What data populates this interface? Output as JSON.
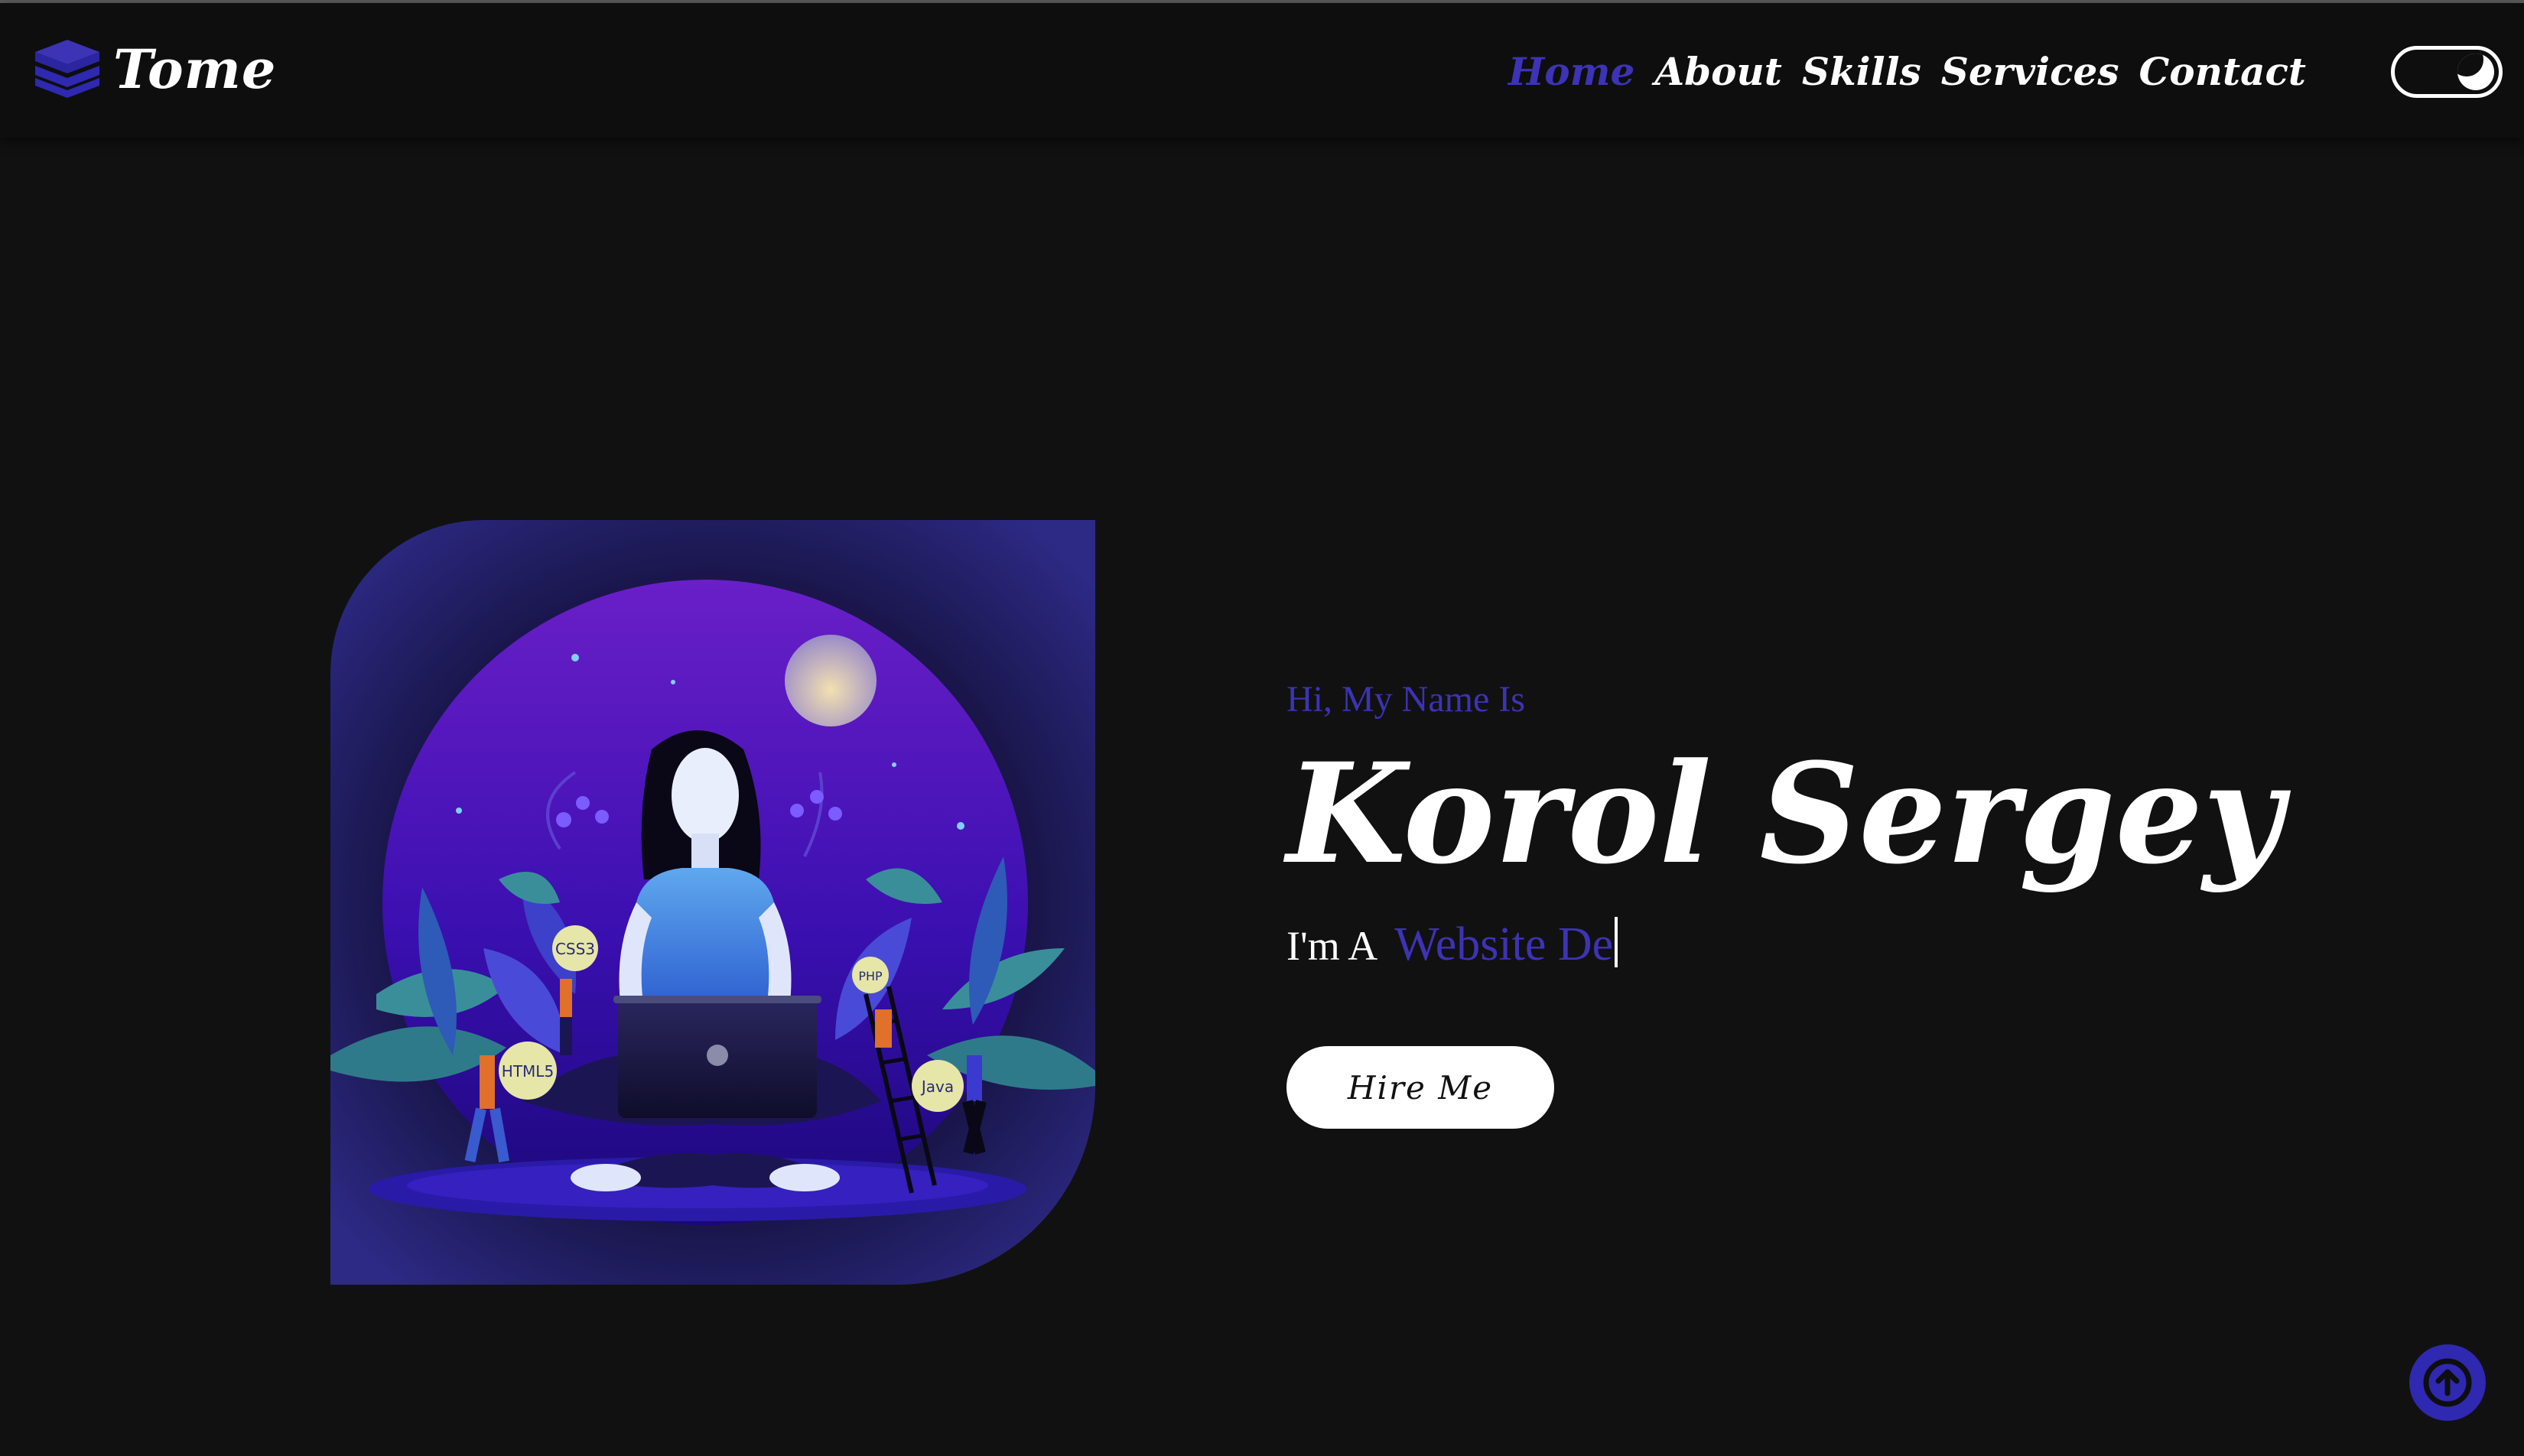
{
  "brand": {
    "name": "Tome",
    "icon": "stacked-layers-icon"
  },
  "nav": {
    "items": [
      {
        "label": "Home",
        "active": true
      },
      {
        "label": "About",
        "active": false
      },
      {
        "label": "Skills",
        "active": false
      },
      {
        "label": "Services",
        "active": false
      },
      {
        "label": "Contact",
        "active": false
      }
    ]
  },
  "theme_toggle": {
    "icon": "moon-icon",
    "state": "dark"
  },
  "hero": {
    "greeting": "Hi, My Name Is",
    "name": "Korol Sergey",
    "role_prefix": "I'm A",
    "role_typed": "Website De",
    "cta_label": "Hire Me",
    "illustration_badges": [
      "CSS3",
      "PHP",
      "HTML5",
      "Java"
    ]
  },
  "colors": {
    "accent": "#3d33b5",
    "background": "#111111",
    "navbar": "#0e0e0e",
    "text": "#ffffff"
  },
  "scroll_top": {
    "icon": "arrow-up-icon"
  }
}
